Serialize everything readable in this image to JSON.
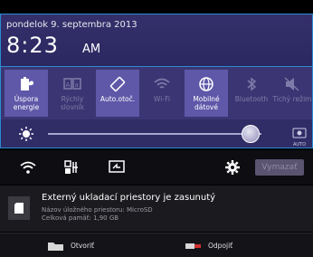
{
  "header": {
    "date": "pondelok 9. septembra 2013",
    "time": "8:23",
    "ampm": "AM"
  },
  "tiles": [
    {
      "label": "Úspora\nenergie",
      "icon": "battery-saver-icon",
      "active": true
    },
    {
      "label": "Rýchly\nslovník",
      "icon": "dictionary-icon",
      "active": false
    },
    {
      "label": "Auto.otoč.",
      "icon": "auto-rotate-icon",
      "active": true
    },
    {
      "label": "Wi-Fi",
      "icon": "wifi-icon",
      "active": false
    },
    {
      "label": "Mobilné\ndátové",
      "icon": "mobile-data-icon",
      "active": true
    },
    {
      "label": "Bluetooth",
      "icon": "bluetooth-icon",
      "active": false
    },
    {
      "label": "Tichý režim",
      "icon": "silent-mode-icon",
      "active": false
    }
  ],
  "brightness": {
    "level": 0.95,
    "auto_label": "AUTO"
  },
  "actions": {
    "clear_label": "Vymazať"
  },
  "notification": {
    "title": "Externý ukladací priestory je zasunutý",
    "line1": "Názov úložného priestoru: MicroSD",
    "line2": "Celková pamäť: 1,90 GB",
    "open_label": "Otvoriť",
    "disconnect_label": "Odpojiť"
  },
  "colors": {
    "accent": "#2a8ad0",
    "panel": "#3b3673",
    "active_tile": "#5f57a8"
  }
}
